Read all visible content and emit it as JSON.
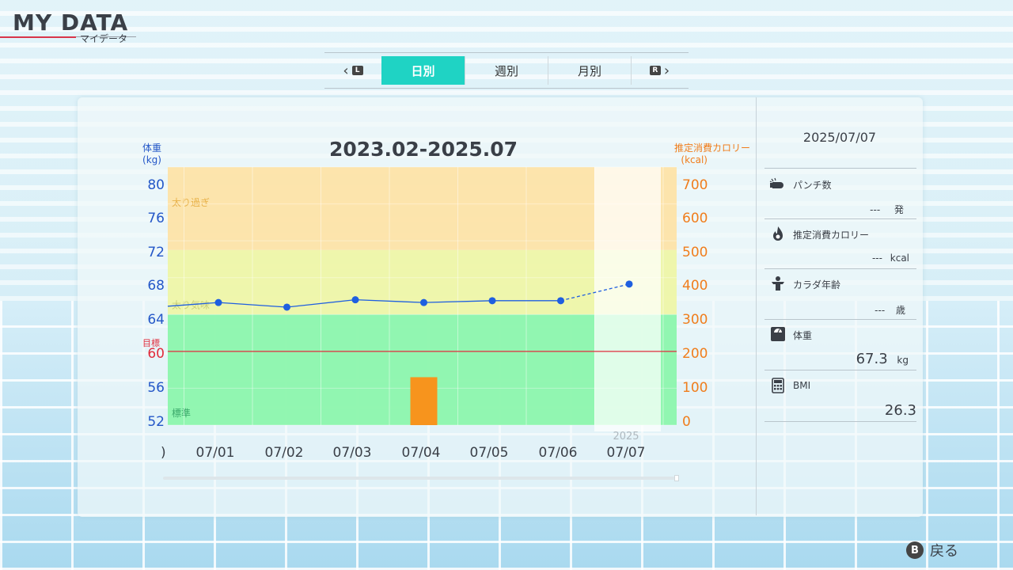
{
  "header": {
    "title": "MY DATA",
    "subtitle": "マイデータ"
  },
  "tabs": {
    "items": [
      {
        "label": "日別",
        "active": true
      },
      {
        "label": "週別",
        "active": false
      },
      {
        "label": "月別",
        "active": false
      }
    ],
    "prev_button": "L",
    "next_button": "R"
  },
  "chart_data": {
    "type": "line",
    "title": "2023.02-2025.07",
    "y_left_label": "体重",
    "y_left_unit": "(kg)",
    "y_right_label": "推定消費カロリー",
    "y_right_unit": "(kcal)",
    "ylim_left": [
      52,
      80
    ],
    "ylim_right": [
      0,
      700
    ],
    "yticks_left": [
      "80",
      "76",
      "72",
      "68",
      "64",
      "60",
      "56",
      "52"
    ],
    "yticks_right": [
      "700",
      "600",
      "500",
      "400",
      "300",
      "200",
      "100",
      "0"
    ],
    "categories": [
      "07/01",
      "07/02",
      "07/03",
      "07/04",
      "07/05",
      "07/06",
      "07/07"
    ],
    "year_label": "2025",
    "series": [
      {
        "values": [
          65.3,
          64.8,
          65.6,
          65.3,
          65.5,
          65.5,
          67.3
        ]
      },
      {
        "type": "bar",
        "values": [
          0,
          0,
          0,
          130,
          0,
          0,
          0
        ]
      }
    ],
    "zones": [
      {
        "label": "太り過ぎ",
        "from": 71,
        "to": 80,
        "color": "#fde3a8"
      },
      {
        "label": "太り気味",
        "from": 64,
        "to": 71,
        "color": "#eef6a8"
      },
      {
        "label": "標準",
        "from": 52,
        "to": 64,
        "color": "#8cf5ad"
      }
    ],
    "goal": {
      "label": "目標",
      "value": 60,
      "display": "60"
    },
    "colors": {
      "line": "#1f5fe0",
      "bar": "#f7941d",
      "goal": "#e02b3c"
    }
  },
  "side": {
    "date": "2025/07/07",
    "stats": [
      {
        "icon": "punch-icon",
        "label": "パンチ数",
        "value": "---",
        "unit": "発"
      },
      {
        "icon": "flame-icon",
        "label": "推定消費カロリー",
        "value": "---",
        "unit": "kcal"
      },
      {
        "icon": "body-age-icon",
        "label": "カラダ年齢",
        "value": "---",
        "unit": "歳"
      },
      {
        "icon": "scale-icon",
        "label": "体重",
        "value": "67.3",
        "unit": "kg"
      },
      {
        "icon": "calculator-icon",
        "label": "BMI",
        "value": "26.3",
        "unit": ""
      }
    ]
  },
  "footer": {
    "back_button_key": "B",
    "back_label": "戻る"
  }
}
